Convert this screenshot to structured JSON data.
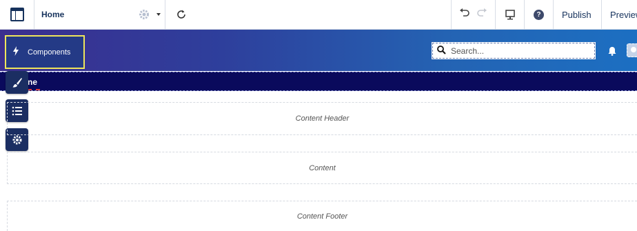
{
  "toolbar": {
    "page_name": "Home",
    "publish_label": "Publish",
    "preview_label": "Preview",
    "icons": {
      "logo": "layout-icon",
      "settings": "gear-icon",
      "refresh": "refresh-icon",
      "undo": "undo-icon",
      "redo": "redo-icon",
      "device": "desktop-icon",
      "help": "help-icon"
    },
    "help_glyph": "?"
  },
  "hero": {
    "components_label": "Components",
    "search_placeholder": "Search...",
    "colors": {
      "highlight": "#f0e65a",
      "gradient_start": "#3b2e8f",
      "gradient_end": "#1c6fc2"
    }
  },
  "navbar": {
    "text": "ne",
    "color": "#0a0a5c"
  },
  "side_tools": [
    {
      "name": "brush",
      "icon": "brush-icon"
    },
    {
      "name": "list",
      "icon": "list-icon"
    },
    {
      "name": "settings",
      "icon": "gear-icon"
    }
  ],
  "regions": {
    "header": "Content Header",
    "content": "Content",
    "footer": "Content Footer"
  }
}
